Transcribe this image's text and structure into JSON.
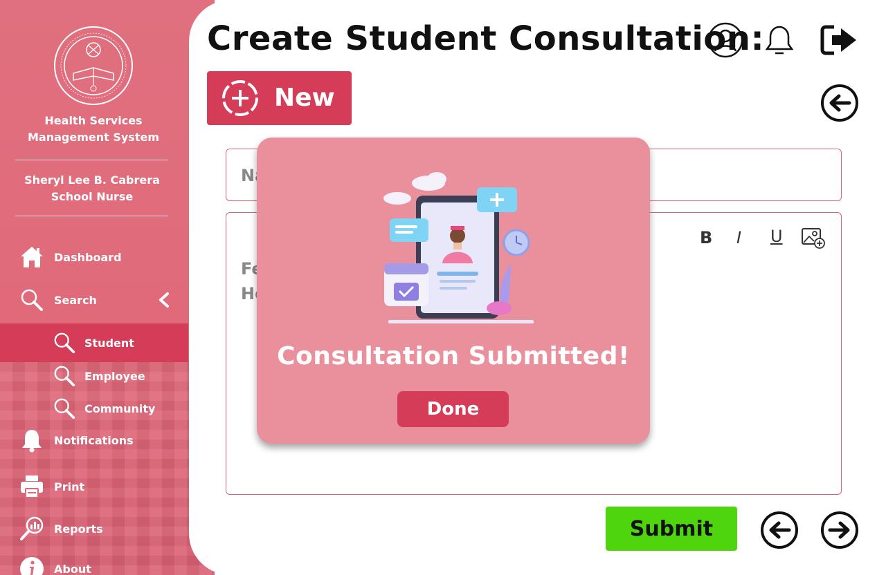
{
  "sidebar": {
    "system_title": "Health Services Management System",
    "user_name": "Sheryl Lee B. Cabrera",
    "user_role": "School Nurse",
    "items": [
      {
        "label": "Dashboard",
        "icon": "home-icon"
      },
      {
        "label": "Search",
        "icon": "search-icon"
      },
      {
        "label": "Student",
        "icon": "search-icon",
        "active": true
      },
      {
        "label": "Employee",
        "icon": "search-icon"
      },
      {
        "label": "Community",
        "icon": "search-icon"
      },
      {
        "label": "Notifications",
        "icon": "bell-icon"
      },
      {
        "label": "Print",
        "icon": "printer-icon"
      },
      {
        "label": "Reports",
        "icon": "reports-icon"
      },
      {
        "label": "About",
        "icon": "info-icon"
      }
    ]
  },
  "header": {
    "title": "Create Student Consultation:",
    "new_button": "New"
  },
  "form": {
    "name_partial": "Na",
    "body_line1_partial": "Fe",
    "body_line2_partial": "He",
    "toolbar": {
      "bold": "B",
      "italic": "I",
      "underline": "U"
    },
    "submit_label": "Submit"
  },
  "modal": {
    "title": "Consultation Submitted!",
    "done_label": "Done"
  },
  "colors": {
    "sidebar": "#e0707f",
    "accent": "#d43c57",
    "modal_bg": "#ea909c",
    "submit": "#4fd50d"
  }
}
